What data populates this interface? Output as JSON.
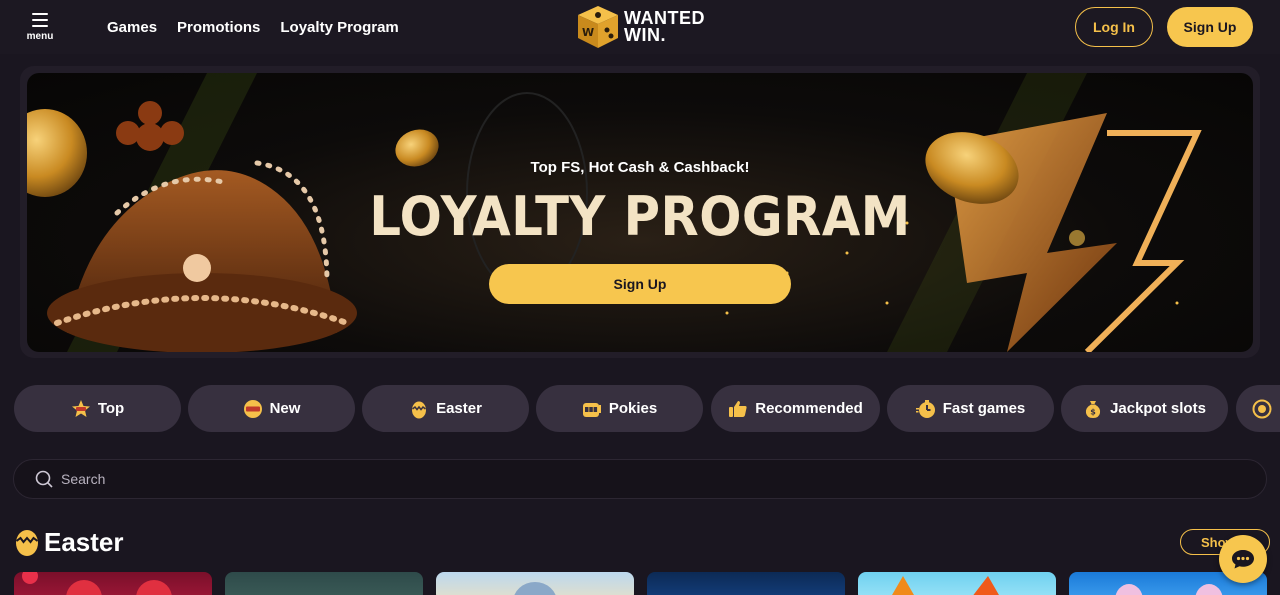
{
  "header": {
    "menu_label": "menu",
    "nav": [
      "Games",
      "Promotions",
      "Loyalty Program"
    ],
    "logo_line1": "WANTED",
    "logo_line2": "WIN.",
    "login_label": "Log In",
    "signup_label": "Sign Up"
  },
  "banner": {
    "subtitle": "Top FS, Hot Cash & Cashback!",
    "title": "LOYALTY PROGRAM",
    "cta_label": "Sign Up"
  },
  "categories": [
    {
      "label": "Top",
      "icon": "top-badge-icon"
    },
    {
      "label": "New",
      "icon": "new-badge-icon"
    },
    {
      "label": "Easter",
      "icon": "easter-egg-icon"
    },
    {
      "label": "Pokies",
      "icon": "slot-machine-icon"
    },
    {
      "label": "Recommended",
      "icon": "thumbs-up-icon"
    },
    {
      "label": "Fast games",
      "icon": "stopwatch-icon"
    },
    {
      "label": "Jackpot slots",
      "icon": "money-bag-icon"
    }
  ],
  "search": {
    "placeholder": "Search"
  },
  "section": {
    "title": "Easter",
    "show_label": "Show all"
  },
  "colors": {
    "accent": "#f7c64e",
    "background": "#1a1620",
    "pill": "#37303f"
  }
}
